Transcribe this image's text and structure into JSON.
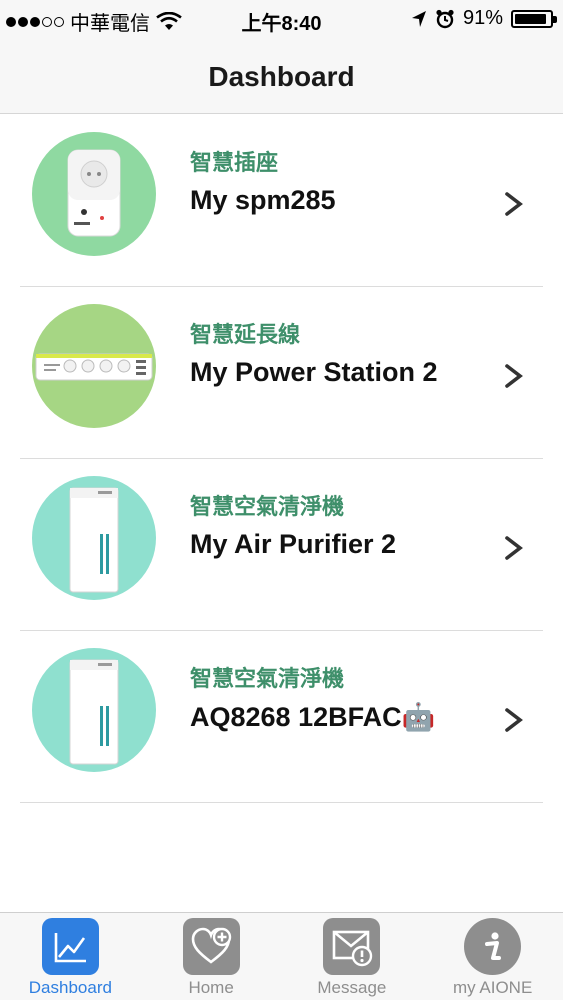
{
  "status_bar": {
    "carrier": "中華電信",
    "time": "上午8:40",
    "battery_percent": "91%",
    "battery_level": 0.91,
    "signal_bars_filled": 3,
    "signal_bars_total": 5
  },
  "nav": {
    "title": "Dashboard"
  },
  "devices": [
    {
      "category": "智慧插座",
      "name": "My spm285",
      "thumb_color": "#8fd9a1",
      "kind": "smart-plug"
    },
    {
      "category": "智慧延長線",
      "name": "My Power Station 2",
      "thumb_color": "#a6d684",
      "kind": "power-strip"
    },
    {
      "category": "智慧空氣清淨機",
      "name": "My Air Purifier 2",
      "thumb_color": "#8fe0cf",
      "kind": "air-purifier"
    },
    {
      "category": "智慧空氣清淨機",
      "name": "AQ8268 12BFAC🤖",
      "thumb_color": "#8fe0cf",
      "kind": "air-purifier"
    }
  ],
  "tabs": [
    {
      "label": "Dashboard",
      "icon": "chart-line-icon",
      "active": true,
      "color": "#2f7fe0"
    },
    {
      "label": "Home",
      "icon": "heart-plus-icon",
      "active": false,
      "color": "#8e8e8e"
    },
    {
      "label": "Message",
      "icon": "message-alert-icon",
      "active": false,
      "color": "#8e8e8e"
    },
    {
      "label": "my AIONE",
      "icon": "info-icon",
      "active": false,
      "color": "#8e8e8e"
    }
  ],
  "colors": {
    "category_text": "#3e8f6a",
    "active_tab": "#2f7fe0",
    "inactive_tab": "#8e8e8e"
  }
}
